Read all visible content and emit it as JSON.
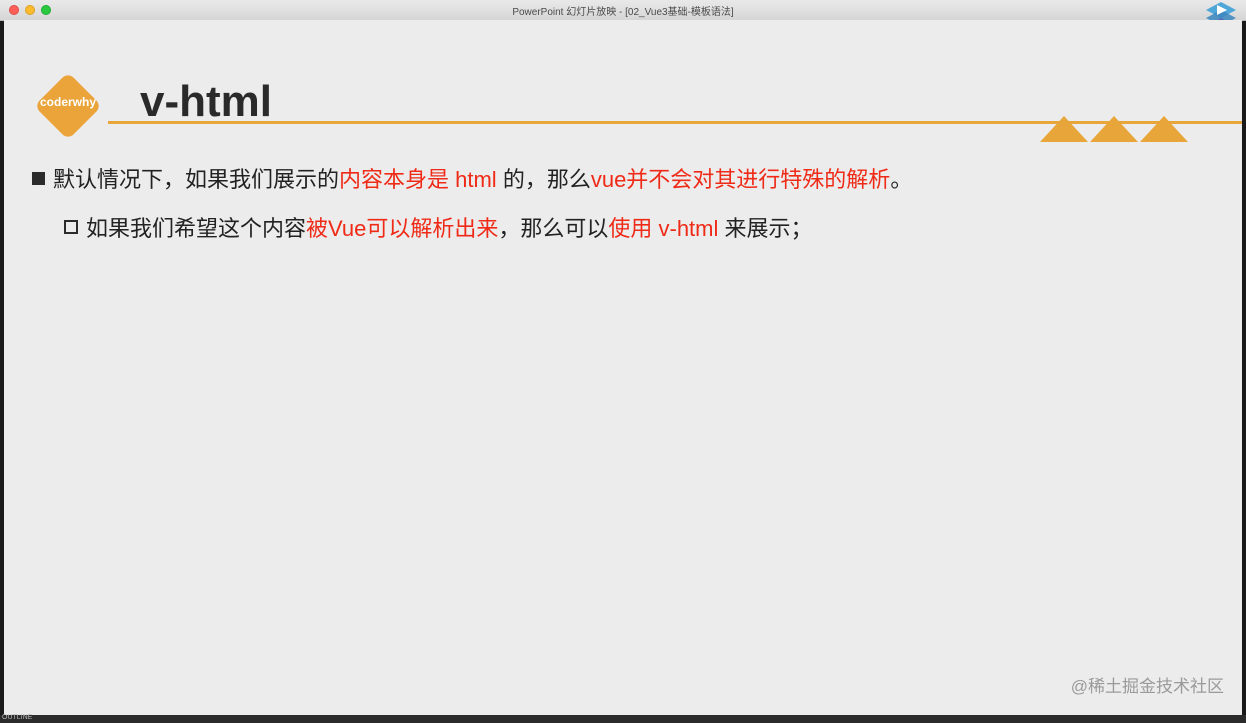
{
  "window": {
    "title": "PowerPoint 幻灯片放映 - [02_Vue3基础-模板语法]"
  },
  "slide": {
    "brand": "coderwhy",
    "title": "v-html",
    "bullet1": {
      "p1": "默认情况下，如果我们展示的",
      "p2": "内容本身是 html",
      "p3": " 的，那么",
      "p4": "vue并不会对其进行特殊的解析",
      "p5": "。"
    },
    "bullet2": {
      "p1": "如果我们希望这个内容",
      "p2": "被Vue可以解析出来",
      "p3": "，那么可以",
      "p4": "使用 v-html",
      "p5": " 来展示；"
    },
    "watermark": "@稀土掘金技术社区"
  },
  "bottom": {
    "label": "OUTLINE"
  },
  "colors": {
    "accent": "#e8a63a",
    "highlight": "#ef2a17"
  }
}
